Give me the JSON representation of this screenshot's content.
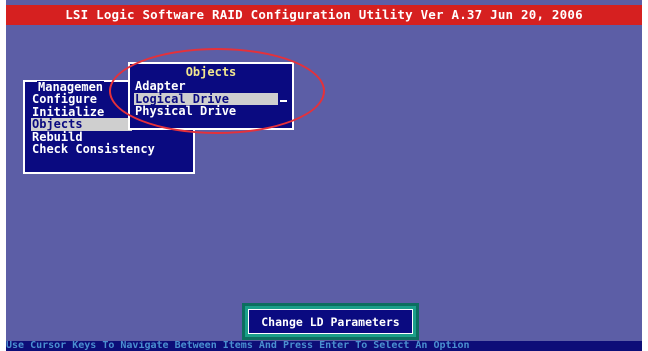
{
  "header": {
    "title": "LSI Logic Software RAID Configuration Utility Ver A.37 Jun 20, 2006"
  },
  "management_menu": {
    "title": "Managemen",
    "items": [
      {
        "label": "Configure"
      },
      {
        "label": "Initialize"
      },
      {
        "label": "Objects",
        "selected": true
      },
      {
        "label": "Rebuild"
      },
      {
        "label": "Check Consistency"
      }
    ]
  },
  "objects_menu": {
    "title": "Objects",
    "items": [
      {
        "label": "Adapter"
      },
      {
        "label": "Logical Drive",
        "selected": true
      },
      {
        "label": "Physical Drive"
      }
    ]
  },
  "action_button": {
    "label": "Change LD Parameters"
  },
  "status_bar": {
    "text": "Use Cursor Keys To Navigate Between Items And Press Enter To Select An Option"
  },
  "colors": {
    "background": "#5c5ea6",
    "title_bar": "#d62020",
    "menu": "#0a0a80",
    "selection": "#cfcfcf",
    "annotation_ring": "#e5313a",
    "button_frame": "#1b9f8a"
  }
}
